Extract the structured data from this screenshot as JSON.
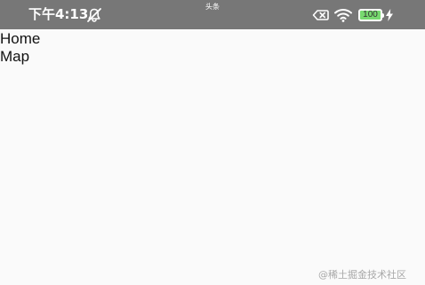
{
  "status_bar": {
    "time": "下午4:13",
    "app_icons": [
      {
        "name": "green-app-icon",
        "glyph": ""
      },
      {
        "name": "orange-app-icon",
        "glyph": ""
      },
      {
        "name": "red-app-icon",
        "glyph": "头条"
      }
    ],
    "battery_level": "100",
    "icons": [
      "mute-bell-icon",
      "battery-x-icon",
      "wifi-icon",
      "charging-bolt-icon"
    ]
  },
  "nav": {
    "items": [
      {
        "label": "Home"
      },
      {
        "label": "Map"
      }
    ]
  },
  "watermark": "@稀土掘金技术社区",
  "colors": {
    "status_bar": "#777777",
    "page_background": "#fafafa",
    "battery_fill": "#77d96f"
  }
}
